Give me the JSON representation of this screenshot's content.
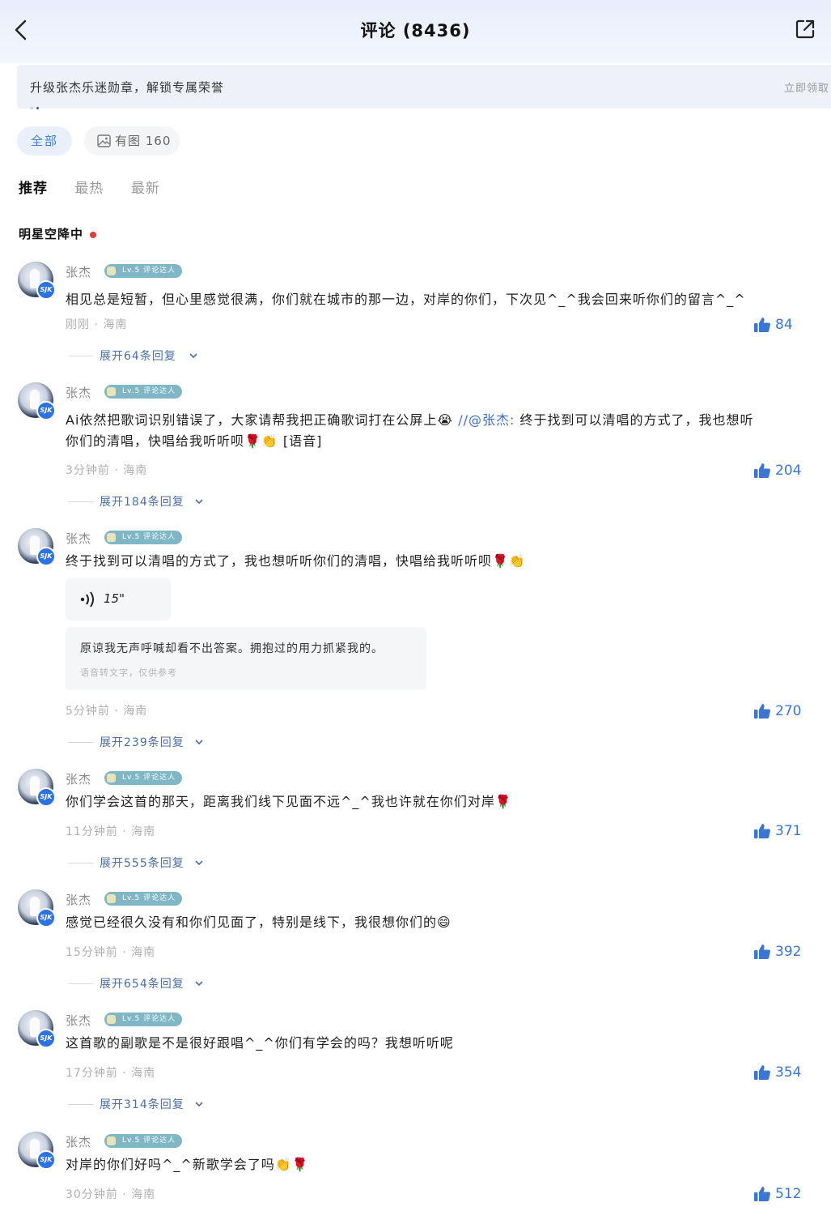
{
  "header": {
    "title": "评论 (8436)",
    "back_icon": "chevron-left-icon",
    "share_icon": "share-external-icon"
  },
  "banner": {
    "text": "升级张杰乐迷勋章，解锁专属荣誉",
    "action": "立即领取"
  },
  "filters": {
    "all": "全部",
    "with_images": "有图 160"
  },
  "sort_tabs": [
    "推荐",
    "最热",
    "最新"
  ],
  "section_title": "明星空降中",
  "colors": {
    "accent": "#3b76d6",
    "live_dot": "#e53935",
    "level_badge": "#7fb7c7"
  },
  "comments": [
    {
      "author": "张杰",
      "level": "Lv.5 评论达人",
      "text": "相见总是短暂，但心里感觉很满，你们就在城市的那一边，对岸的你们，下次见^_^我会回来听你们的留言^_^",
      "meta": "刚刚 · 海南",
      "likes": "84",
      "replies": "展开64条回复"
    },
    {
      "author": "张杰",
      "level": "Lv.5 评论达人",
      "text_line1_a": "Ai依然把歌词识别错误了，大家请帮我把正确歌词打在公屏上😭 ",
      "mention": "//@张杰:",
      "text_line1_b": " 终于找到可以清唱的方式了，我也想听",
      "text_line2": "你们的清唱，快唱给我听听呗🌹👏 [语音]",
      "meta": "3分钟前 · 海南",
      "likes": "204",
      "replies": "展开184条回复"
    },
    {
      "author": "张杰",
      "level": "Lv.5 评论达人",
      "text": "终于找到可以清唱的方式了，我也想听听你们的清唱，快唱给我听听呗🌹👏",
      "voice_duration": "15\"",
      "transcript": "原谅我无声呼喊却看不出答案。拥抱过的用力抓紧我的。",
      "transcript_note": "语音转文字，仅供参考",
      "meta": "5分钟前 · 海南",
      "likes": "270",
      "replies": "展开239条回复"
    },
    {
      "author": "张杰",
      "level": "Lv.5 评论达人",
      "text": "你们学会这首的那天，距离我们线下见面不远^_^我也许就在你们对岸🌹",
      "meta": "11分钟前 · 海南",
      "likes": "371",
      "replies": "展开555条回复"
    },
    {
      "author": "张杰",
      "level": "Lv.5 评论达人",
      "text": "感觉已经很久没有和你们见面了，特别是线下，我很想你们的😄",
      "meta": "15分钟前 · 海南",
      "likes": "392",
      "replies": "展开654条回复"
    },
    {
      "author": "张杰",
      "level": "Lv.5 评论达人",
      "text": "这首歌的副歌是不是很好跟唱^_^你们有学会的吗？我想听听呢",
      "meta": "17分钟前 · 海南",
      "likes": "354",
      "replies": "展开314条回复"
    },
    {
      "author": "张杰",
      "level": "Lv.5 评论达人",
      "text": "对岸的你们好吗^_^新歌学会了吗👏🌹",
      "meta": "30分钟前 · 海南",
      "likes": "512"
    }
  ]
}
